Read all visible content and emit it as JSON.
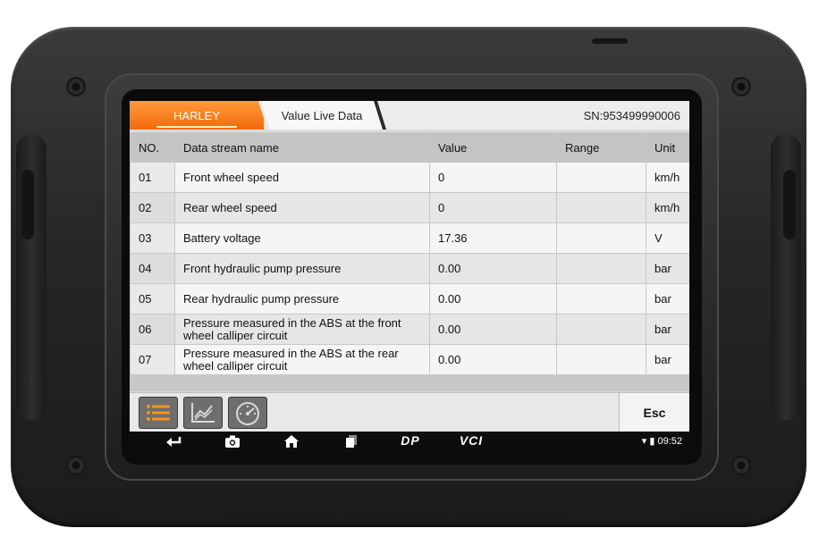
{
  "header": {
    "active_tab": "HARLEY",
    "second_tab": "Value Live Data",
    "serial": "SN:953499990006"
  },
  "table": {
    "columns": [
      "NO.",
      "Data stream name",
      "Value",
      "Range",
      "Unit"
    ],
    "rows": [
      {
        "no": "01",
        "name": "Front wheel speed",
        "value": "0",
        "range": "",
        "unit": "km/h"
      },
      {
        "no": "02",
        "name": "Rear wheel speed",
        "value": "0",
        "range": "",
        "unit": "km/h"
      },
      {
        "no": "03",
        "name": "Battery voltage",
        "value": "17.36",
        "range": "",
        "unit": "V"
      },
      {
        "no": "04",
        "name": "Front hydraulic pump pressure",
        "value": "0.00",
        "range": "",
        "unit": "bar"
      },
      {
        "no": "05",
        "name": "Rear hydraulic pump pressure",
        "value": "0.00",
        "range": "",
        "unit": "bar"
      },
      {
        "no": "06",
        "name": "Pressure measured in the ABS at the front wheel calliper circuit",
        "value": "0.00",
        "range": "",
        "unit": "bar"
      },
      {
        "no": "07",
        "name": "Pressure measured in the ABS at the rear wheel calliper circuit",
        "value": "0.00",
        "range": "",
        "unit": "bar"
      }
    ]
  },
  "toolbar": {
    "buttons": [
      {
        "icon": "list-icon",
        "active": true
      },
      {
        "icon": "graph-icon",
        "active": false
      },
      {
        "icon": "gauge-icon",
        "active": false
      }
    ],
    "esc_label": "Esc"
  },
  "nav": {
    "dp_label": "DP",
    "vci_label": "VCI",
    "time": "09:52"
  },
  "colors": {
    "accent": "#f26a0b",
    "icon_active": "#f7931e",
    "icon_inactive": "#d9d9d9"
  }
}
